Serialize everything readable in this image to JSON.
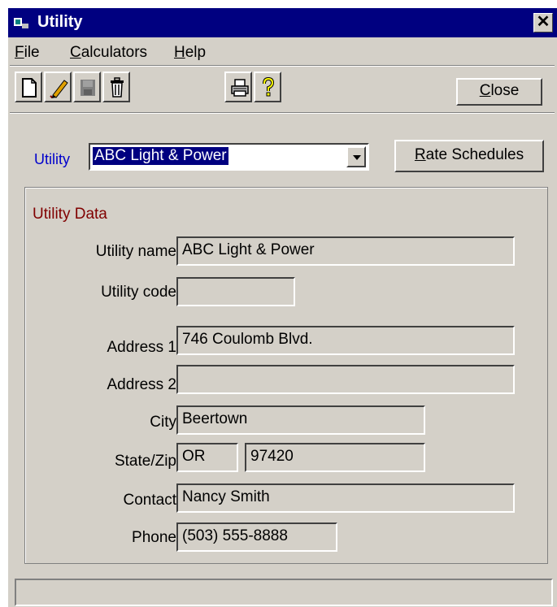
{
  "window": {
    "title": "Utility",
    "close_glyph": "✕"
  },
  "menu": {
    "items": [
      {
        "label": "File",
        "access_key": "F",
        "rest": "ile"
      },
      {
        "label": "Calculators",
        "access_key": "C",
        "rest": "alculators"
      },
      {
        "label": "Help",
        "access_key": "H",
        "rest": "elp"
      }
    ]
  },
  "toolbar": {
    "icons": [
      "new-document-icon",
      "edit-pencil-icon",
      "save-disk-icon",
      "delete-trash-icon",
      "print-icon",
      "help-question-icon"
    ],
    "close": {
      "label": "Close",
      "access_key": "C",
      "rest": "lose"
    }
  },
  "selector": {
    "label": "Utility",
    "value": "ABC Light & Power",
    "rate_button": {
      "label": "Rate Schedules",
      "access_key": "R",
      "rest": "ate Schedules"
    }
  },
  "utility_data": {
    "title": "Utility Data",
    "fields": {
      "utility_name": {
        "label": "Utility name",
        "value": "ABC Light & Power"
      },
      "utility_code": {
        "label": "Utility code",
        "value": ""
      },
      "address1": {
        "label": "Address 1",
        "value": "746 Coulomb Blvd."
      },
      "address2": {
        "label": "Address 2",
        "value": ""
      },
      "city": {
        "label": "City",
        "value": "Beertown"
      },
      "state_zip": {
        "label": "State/Zip",
        "state": "OR",
        "zip": "97420"
      },
      "contact": {
        "label": "Contact",
        "value": "Nancy Smith"
      },
      "phone": {
        "label": "Phone",
        "value": "(503) 555-8888"
      }
    }
  },
  "colors": {
    "title_bar": "#000080",
    "face": "#d4d0c8",
    "label_blue": "#0000cc",
    "frame_title": "#800000",
    "selection": "#000080"
  },
  "status": {
    "text": ""
  }
}
